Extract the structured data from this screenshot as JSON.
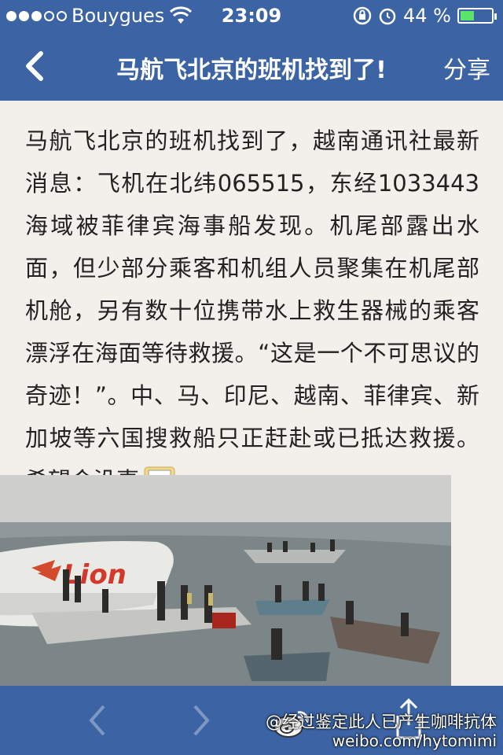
{
  "status": {
    "carrier": "Bouygues",
    "time": "23:09",
    "battery_text": "44 %",
    "battery_level": 0.44
  },
  "nav": {
    "title": "马航飞北京的班机找到了!",
    "share": "分享"
  },
  "article": {
    "body": "马航飞北京的班机找到了，越南通讯社最新消息：飞机在北纬065515，东经1033443海域被菲律宾海事船发现。机尾部露出水面，但少部分乘客和机组人员聚集在机尾部机舱，另有数十位携带水上救生器械的乘客漂浮在海面等待救援。“这是一个不可思议的奇迹！”。中、马、印尼、越南、菲律宾、新加坡等六国搜救船只正赶赴或已抵达救援。希望会没事"
  },
  "photo": {
    "logo_text": "Lion"
  },
  "watermark": {
    "line1": "@经过鉴定此人已产生咖啡抗体",
    "line2": "weibo.com/hytomimi"
  },
  "colors": {
    "bar": "#3c63a4",
    "text": "#222222",
    "background": "#f3f0ec"
  }
}
